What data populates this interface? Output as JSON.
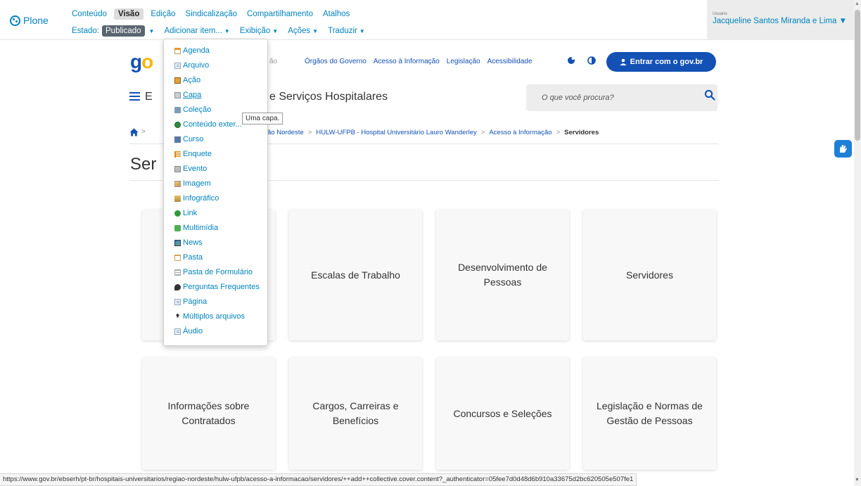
{
  "toolbar": {
    "logo_text": "Plone",
    "tabs": [
      {
        "label": "Conteúdo",
        "active": false
      },
      {
        "label": "Visão",
        "active": true
      },
      {
        "label": "Edição",
        "active": false
      },
      {
        "label": "Sindicalização",
        "active": false
      },
      {
        "label": "Compartilhamento",
        "active": false
      },
      {
        "label": "Atalhos",
        "active": false
      }
    ],
    "state_label": "Estado:",
    "state_value": "Publicado",
    "menus": {
      "add": "Adicionar item...",
      "display": "Exibição",
      "actions": "Ações",
      "translate": "Traduzir"
    },
    "user_label": "Usuario",
    "user_name": "Jacqueline Santos Miranda e Lima ▼"
  },
  "add_menu": {
    "items": [
      {
        "label": "Agenda",
        "icon": "calendar-icon"
      },
      {
        "label": "Arquivo",
        "icon": "file-icon"
      },
      {
        "label": "Ação",
        "icon": "action-icon"
      },
      {
        "label": "Capa",
        "icon": "cover-icon"
      },
      {
        "label": "Coleção",
        "icon": "collection-icon"
      },
      {
        "label": "Conteúdo exter...",
        "icon": "external-content-icon"
      },
      {
        "label": "Curso",
        "icon": "course-icon"
      },
      {
        "label": "Enquete",
        "icon": "poll-icon"
      },
      {
        "label": "Evento",
        "icon": "event-icon"
      },
      {
        "label": "Imagem",
        "icon": "image-icon"
      },
      {
        "label": "Infográfico",
        "icon": "infographic-icon"
      },
      {
        "label": "Link",
        "icon": "link-icon"
      },
      {
        "label": "Multimídia",
        "icon": "multimedia-icon"
      },
      {
        "label": "News",
        "icon": "news-icon"
      },
      {
        "label": "Pasta",
        "icon": "folder-icon"
      },
      {
        "label": "Pasta de Formulário",
        "icon": "form-folder-icon"
      },
      {
        "label": "Perguntas Frequentes",
        "icon": "faq-icon"
      },
      {
        "label": "Página",
        "icon": "page-icon"
      },
      {
        "label": "Múltiplos arquivos",
        "icon": "upload-icon"
      },
      {
        "label": "Áudio",
        "icon": "audio-icon"
      }
    ],
    "tooltip": "Uma capa."
  },
  "header": {
    "logo_g": "g",
    "logo_o": "o",
    "hidden_text": "ão",
    "links": [
      "Órgãos do Governo",
      "Acesso à Informação",
      "Legislação",
      "Acessibilidade"
    ],
    "login_label": "Entrar com o gov.br",
    "site_title_left": "E",
    "site_title": "e Serviços Hospitalares",
    "search_placeholder": "O que você procura?"
  },
  "breadcrumb": {
    "left": ">",
    "items": [
      "ão Nordeste",
      "HULW-UFPB - Hospital Universitário Lauro Wanderley",
      "Acesso à Informação"
    ],
    "current": "Servidores",
    "separator": ">"
  },
  "page_title": "Ser",
  "cards": [
    {
      "title": ""
    },
    {
      "title": "Escalas de Trabalho"
    },
    {
      "title": "Desenvolvimento de Pessoas"
    },
    {
      "title": "Servidores"
    },
    {
      "title": "Informações sobre Contratados"
    },
    {
      "title": "Cargos, Carreiras e Benefícios"
    },
    {
      "title": "Concursos e Seleções"
    },
    {
      "title": "Legislação e Normas de Gestão de Pessoas"
    }
  ],
  "status_url": "https://www.gov.br/ebserh/pt-br/hospitais-universitarios/regiao-nordeste/hulw-ufpb/acesso-a-informacao/servidores/++add++collective.cover.content?_authenticator=05fee7d0d48d6b910a33675d2bc620505e507fe1",
  "colors": {
    "plone_blue": "#0083be",
    "gov_blue": "#1351b4",
    "gov_yellow": "#f8b600"
  }
}
